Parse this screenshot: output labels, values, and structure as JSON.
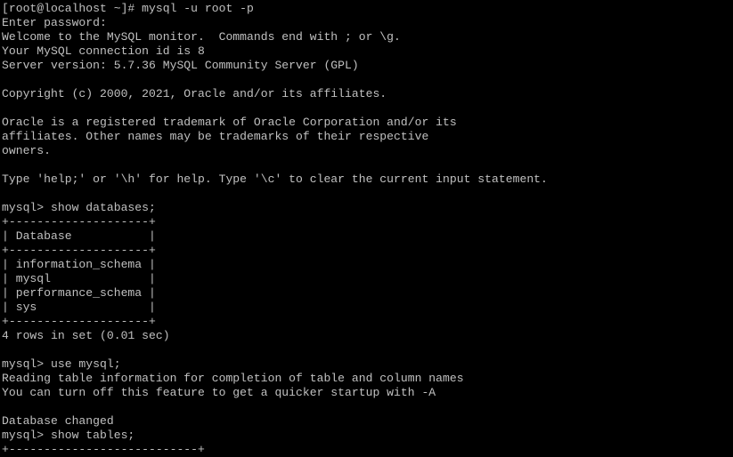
{
  "terminal": {
    "lines": [
      "[root@localhost ~]# mysql -u root -p",
      "Enter password:",
      "Welcome to the MySQL monitor.  Commands end with ; or \\g.",
      "Your MySQL connection id is 8",
      "Server version: 5.7.36 MySQL Community Server (GPL)",
      "",
      "Copyright (c) 2000, 2021, Oracle and/or its affiliates.",
      "",
      "Oracle is a registered trademark of Oracle Corporation and/or its",
      "affiliates. Other names may be trademarks of their respective",
      "owners.",
      "",
      "Type 'help;' or '\\h' for help. Type '\\c' to clear the current input statement.",
      "",
      "mysql> show databases;",
      "+--------------------+",
      "| Database           |",
      "+--------------------+",
      "| information_schema |",
      "| mysql              |",
      "| performance_schema |",
      "| sys                |",
      "+--------------------+",
      "4 rows in set (0.01 sec)",
      "",
      "mysql> use mysql;",
      "Reading table information for completion of table and column names",
      "You can turn off this feature to get a quicker startup with -A",
      "",
      "Database changed",
      "mysql> show tables;",
      "+---------------------------+"
    ]
  }
}
